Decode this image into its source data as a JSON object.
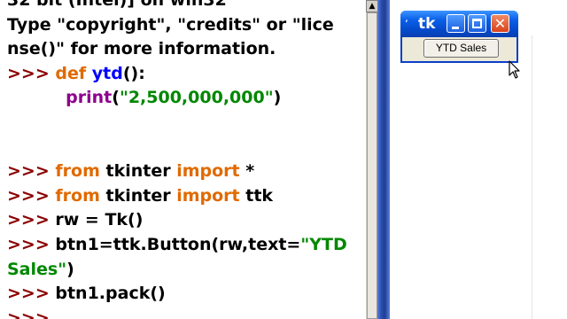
{
  "shell": {
    "lines": [
      [
        {
          "t": "32 bit (Intel)] on win32",
          "c": "dim"
        }
      ],
      [
        {
          "t": "Type \"copyright\", \"credits\" or \"lice",
          "c": "dim"
        }
      ],
      [
        {
          "t": "nse()\" for more information.",
          "c": "dim"
        }
      ],
      [
        {
          "t": ">>> ",
          "c": "prompt"
        },
        {
          "t": "def ",
          "c": "kw"
        },
        {
          "t": "ytd",
          "c": "fn"
        },
        {
          "t": "():",
          "c": "dim"
        }
      ],
      [
        {
          "t": "          ",
          "c": "dim"
        },
        {
          "t": "print",
          "c": "bi"
        },
        {
          "t": "(",
          "c": "dim"
        },
        {
          "t": "\"2,500,000,000\"",
          "c": "str"
        },
        {
          "t": ")",
          "c": "dim"
        }
      ],
      [
        {
          "t": "",
          "c": "dim"
        }
      ],
      [
        {
          "t": "",
          "c": "dim"
        }
      ],
      [
        {
          "t": ">>> ",
          "c": "prompt"
        },
        {
          "t": "from ",
          "c": "kw"
        },
        {
          "t": "tkinter ",
          "c": "dim"
        },
        {
          "t": "import ",
          "c": "kw"
        },
        {
          "t": "*",
          "c": "dim"
        }
      ],
      [
        {
          "t": ">>> ",
          "c": "prompt"
        },
        {
          "t": "from ",
          "c": "kw"
        },
        {
          "t": "tkinter ",
          "c": "dim"
        },
        {
          "t": "import ",
          "c": "kw"
        },
        {
          "t": "ttk",
          "c": "dim"
        }
      ],
      [
        {
          "t": ">>> ",
          "c": "prompt"
        },
        {
          "t": "rw = Tk()",
          "c": "dim"
        }
      ],
      [
        {
          "t": ">>> ",
          "c": "prompt"
        },
        {
          "t": "btn1=ttk.Button(rw,text=",
          "c": "dim"
        },
        {
          "t": "\"YTD",
          "c": "str"
        }
      ],
      [
        {
          "t": "Sales\"",
          "c": "str"
        },
        {
          "t": ")",
          "c": "dim"
        }
      ],
      [
        {
          "t": ">>> ",
          "c": "prompt"
        },
        {
          "t": "btn1.pack()",
          "c": "dim"
        }
      ],
      [
        {
          "t": ">>> ",
          "c": "prompt"
        }
      ]
    ]
  },
  "tk_window": {
    "title": "tk",
    "button_label": "YTD Sales",
    "close_glyph": "✕"
  },
  "scrollbar": {
    "arrow_glyph": "▲"
  },
  "icons": {
    "window_icon": "feather-icon",
    "cursor": "mouse-pointer-icon"
  },
  "colors": {
    "prompt": "#8b0000",
    "keyword": "#e06a00",
    "builtin": "#8e008e",
    "function_name": "#0000ff",
    "string": "#008800",
    "titlebar": "#0a5fe8"
  }
}
